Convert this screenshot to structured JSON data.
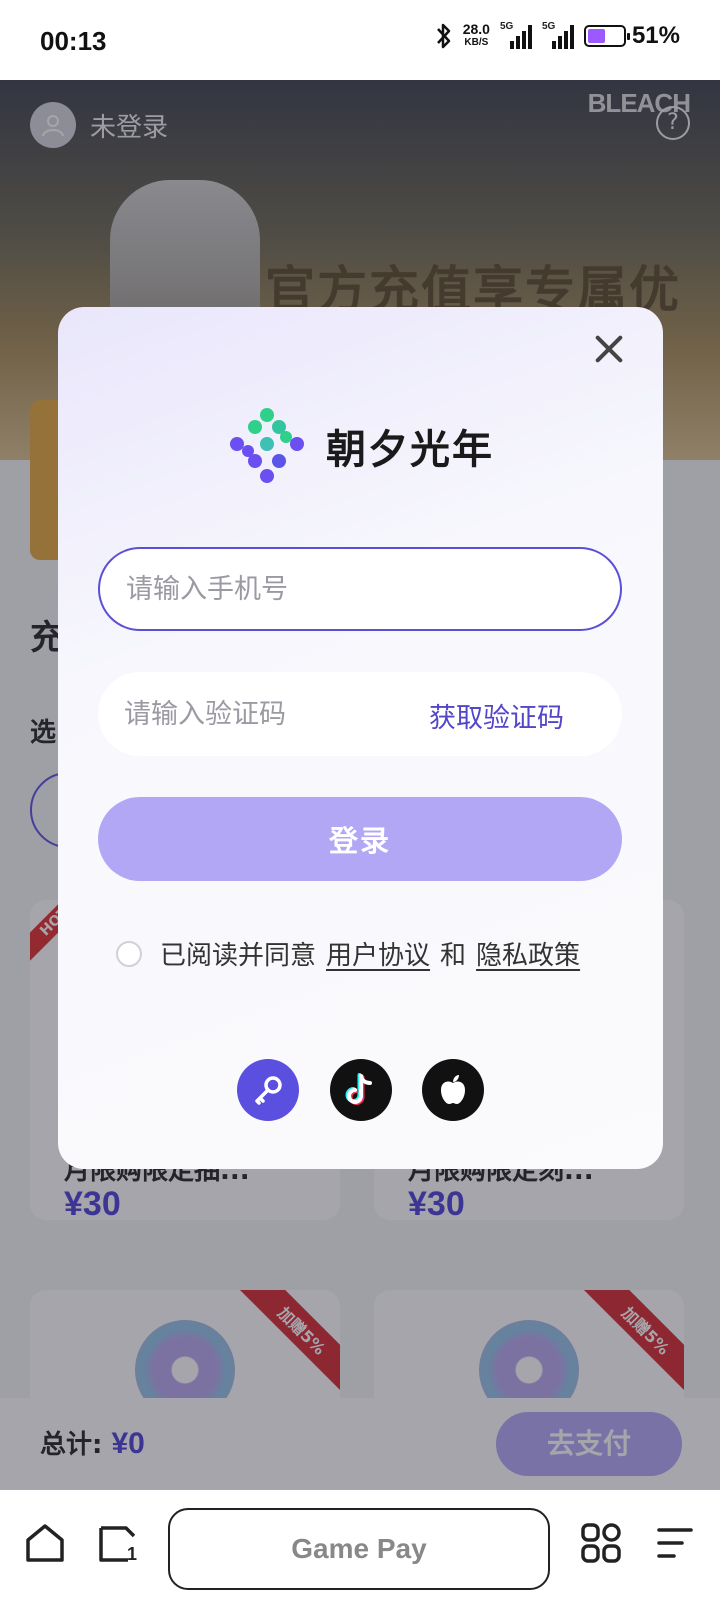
{
  "status_bar": {
    "time": "00:13",
    "net_speed": "28.0",
    "net_unit": "KB/S",
    "signal1_label": "5G",
    "signal2_label": "5G",
    "battery": "51%",
    "battery_level": 0.51
  },
  "page": {
    "user_name": "未登录",
    "banner_logo": "BLEACH",
    "banner_title": "官方充值享专属优惠",
    "section_title": "充",
    "section_sub": "选",
    "products": [
      {
        "name": "月限购限定抽...",
        "price": "¥30",
        "badge": "HOT"
      },
      {
        "name": "月限购限定刻...",
        "price": "¥30",
        "badge": ""
      },
      {
        "name": "",
        "price": "",
        "badge": "加赠5%"
      },
      {
        "name": "",
        "price": "",
        "badge": "加赠5%"
      }
    ],
    "total_label": "总计:",
    "total_value": "¥0",
    "pay_button": "去支付"
  },
  "modal": {
    "brand_name": "朝夕光年",
    "phone_placeholder": "请输入手机号",
    "code_placeholder": "请输入验证码",
    "get_code": "获取验证码",
    "login_button": "登录",
    "agree_text": "已阅读并同意",
    "user_agreement": "用户协议",
    "and": "和",
    "privacy_policy": "隐私政策",
    "social_icons": [
      "key-icon",
      "tiktok-icon",
      "apple-icon"
    ]
  },
  "browser": {
    "address": "Game Pay",
    "tab_count": "1"
  },
  "colors": {
    "accent": "#5b4fe0",
    "login_button": "#b2a7f4",
    "price": "#4a3fd6"
  }
}
